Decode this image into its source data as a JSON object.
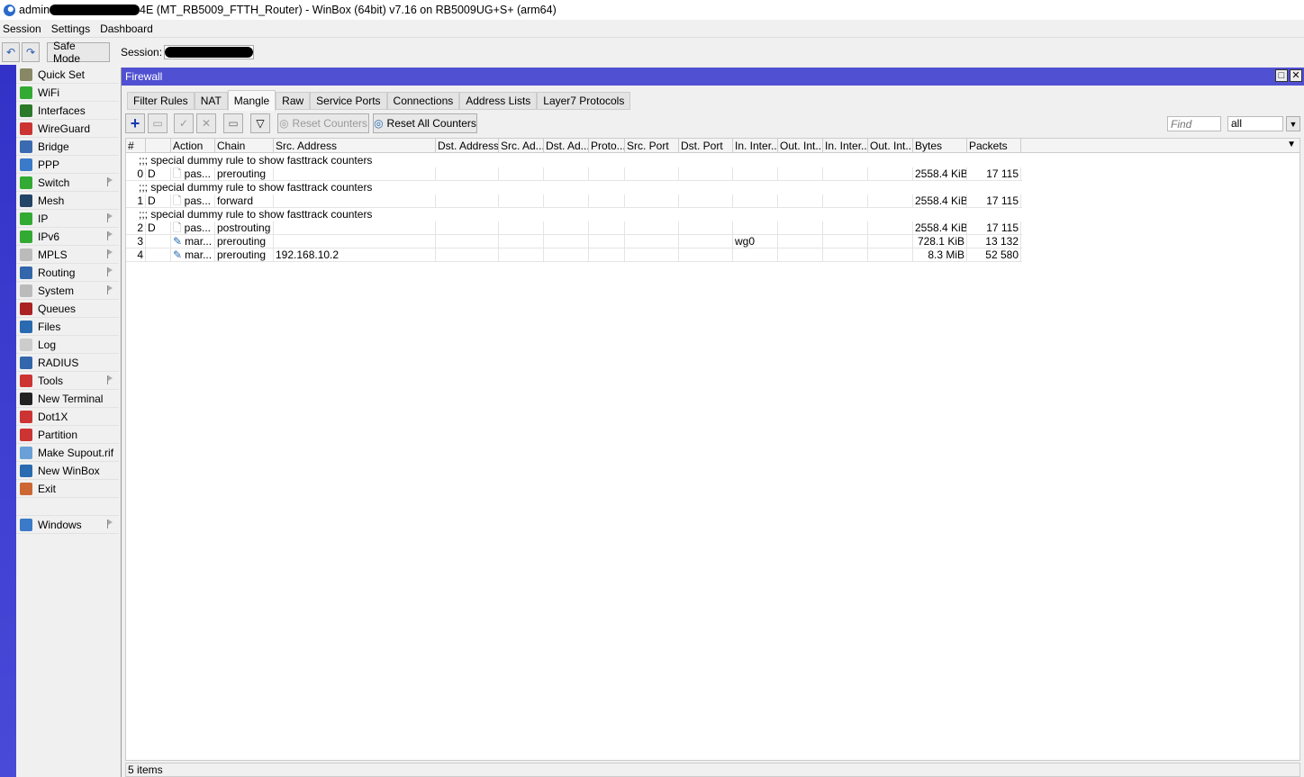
{
  "app": {
    "title_prefix": "admin",
    "title_suffix": "4E (MT_RB5009_FTTH_Router) - WinBox (64bit) v7.16 on RB5009UG+S+ (arm64)"
  },
  "menu": [
    "Session",
    "Settings",
    "Dashboard"
  ],
  "toolbar": {
    "safe_mode": "Safe Mode",
    "session_label": "Session:"
  },
  "sidebar": [
    {
      "label": "Quick Set",
      "icon": "wand-icon",
      "color": "#886",
      "sub": false
    },
    {
      "label": "WiFi",
      "icon": "wifi-icon",
      "color": "#3a3",
      "sub": false
    },
    {
      "label": "Interfaces",
      "icon": "interfaces-icon",
      "color": "#2a7a2a",
      "sub": false
    },
    {
      "label": "WireGuard",
      "icon": "wireguard-icon",
      "color": "#c33",
      "sub": false
    },
    {
      "label": "Bridge",
      "icon": "bridge-icon",
      "color": "#3a6ab0",
      "sub": false
    },
    {
      "label": "PPP",
      "icon": "ppp-icon",
      "color": "#3a7ac8",
      "sub": false
    },
    {
      "label": "Switch",
      "icon": "switch-icon",
      "color": "#3a3",
      "sub": true
    },
    {
      "label": "Mesh",
      "icon": "mesh-icon",
      "color": "#246",
      "sub": false
    },
    {
      "label": "IP",
      "icon": "ip-icon",
      "color": "#3a3",
      "sub": true
    },
    {
      "label": "IPv6",
      "icon": "ipv6-icon",
      "color": "#3a3",
      "sub": true
    },
    {
      "label": "MPLS",
      "icon": "mpls-icon",
      "color": "#bbb",
      "sub": true
    },
    {
      "label": "Routing",
      "icon": "routing-icon",
      "color": "#36a",
      "sub": true
    },
    {
      "label": "System",
      "icon": "system-icon",
      "color": "#bbb",
      "sub": true
    },
    {
      "label": "Queues",
      "icon": "queues-icon",
      "color": "#a22",
      "sub": false
    },
    {
      "label": "Files",
      "icon": "files-icon",
      "color": "#2a6ab0",
      "sub": false
    },
    {
      "label": "Log",
      "icon": "log-icon",
      "color": "#ccc",
      "sub": false
    },
    {
      "label": "RADIUS",
      "icon": "radius-icon",
      "color": "#36a",
      "sub": false
    },
    {
      "label": "Tools",
      "icon": "tools-icon",
      "color": "#c33",
      "sub": true
    },
    {
      "label": "New Terminal",
      "icon": "terminal-icon",
      "color": "#222",
      "sub": false
    },
    {
      "label": "Dot1X",
      "icon": "dot1x-icon",
      "color": "#c33",
      "sub": false
    },
    {
      "label": "Partition",
      "icon": "partition-icon",
      "color": "#c33",
      "sub": false
    },
    {
      "label": "Make Supout.rif",
      "icon": "supout-icon",
      "color": "#6aa0d8",
      "sub": false
    },
    {
      "label": "New WinBox",
      "icon": "winbox-icon",
      "color": "#2a6ab0",
      "sub": false
    },
    {
      "label": "Exit",
      "icon": "exit-icon",
      "color": "#c63",
      "sub": false
    },
    {
      "label": "",
      "icon": "",
      "color": "",
      "sub": false
    },
    {
      "label": "Windows",
      "icon": "windows-icon",
      "color": "#3a7ac8",
      "sub": true
    }
  ],
  "firewall": {
    "title": "Firewall",
    "tabs": [
      "Filter Rules",
      "NAT",
      "Mangle",
      "Raw",
      "Service Ports",
      "Connections",
      "Address Lists",
      "Layer7 Protocols"
    ],
    "active_tab": "Mangle",
    "reset_counters": "Reset Counters",
    "reset_all_counters": "Reset All Counters",
    "find_placeholder": "Find",
    "filter_value": "all",
    "columns": [
      "#",
      "",
      "Action",
      "Chain",
      "Src. Address",
      "Dst. Address",
      "Src. Ad...",
      "Dst. Ad...",
      "Proto...",
      "Src. Port",
      "Dst. Port",
      "In. Inter...",
      "Out. Int...",
      "In. Inter...",
      "Out. Int...",
      "Bytes",
      "Packets"
    ],
    "rows": [
      {
        "comment": ";;; special dummy rule to show fasttrack counters"
      },
      {
        "cells": [
          "0",
          "D",
          "pas...",
          "prerouting",
          "",
          "",
          "",
          "",
          "",
          "",
          "",
          "",
          "",
          "",
          "",
          "2558.4 KiB",
          "17 115"
        ],
        "icon": "passthrough"
      },
      {
        "comment": ";;; special dummy rule to show fasttrack counters"
      },
      {
        "cells": [
          "1",
          "D",
          "pas...",
          "forward",
          "",
          "",
          "",
          "",
          "",
          "",
          "",
          "",
          "",
          "",
          "",
          "2558.4 KiB",
          "17 115"
        ],
        "icon": "passthrough"
      },
      {
        "comment": ";;; special dummy rule to show fasttrack counters"
      },
      {
        "cells": [
          "2",
          "D",
          "pas...",
          "postrouting",
          "",
          "",
          "",
          "",
          "",
          "",
          "",
          "",
          "",
          "",
          "",
          "2558.4 KiB",
          "17 115"
        ],
        "icon": "passthrough"
      },
      {
        "cells": [
          "3",
          "",
          "mar...",
          "prerouting",
          "",
          "",
          "",
          "",
          "",
          "",
          "",
          "wg0",
          "",
          "",
          "",
          "728.1 KiB",
          "13 132"
        ],
        "icon": "mark"
      },
      {
        "cells": [
          "4",
          "",
          "mar...",
          "prerouting",
          "192.168.10.2",
          "",
          "",
          "",
          "",
          "",
          "",
          "",
          "",
          "",
          "",
          "8.3 MiB",
          "52 580"
        ],
        "icon": "mark"
      }
    ],
    "status": "5 items"
  }
}
